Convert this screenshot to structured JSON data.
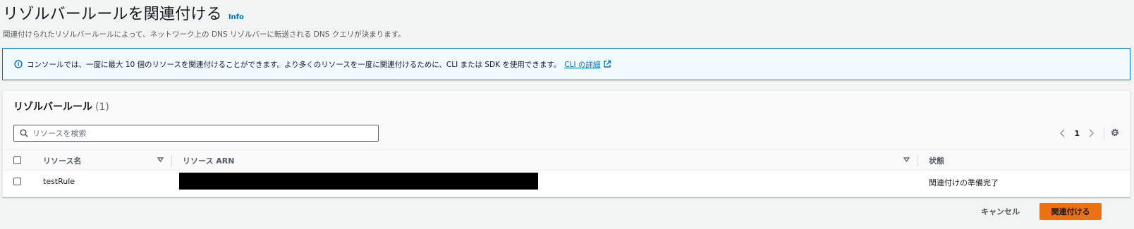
{
  "header": {
    "title": "リゾルバールールを関連付ける",
    "info_label": "Info",
    "description": "関連付けられたリゾルバールールによって、ネットワーク上の DNS リゾルバーに転送される DNS クエリが決まります。"
  },
  "alert": {
    "icon": "info-icon",
    "text": "コンソールでは、一度に最大 10 個のリソースを関連付けることができます。より多くのリソースを一度に関連付けるために、CLI または SDK を使用できます。",
    "link_label": "CLI の詳細",
    "link_icon": "external-link-icon"
  },
  "table": {
    "title": "リゾルバールール",
    "count": "(1)",
    "search": {
      "placeholder": "リソースを検索",
      "value": ""
    },
    "pagination": {
      "current_page": "1"
    },
    "columns": [
      "リソース名",
      "リソース ARN",
      "状態"
    ],
    "rows": [
      {
        "name": "testRule",
        "arn": "",
        "status": "関連付けの準備完了"
      }
    ]
  },
  "footer": {
    "cancel_label": "キャンセル",
    "submit_label": "関連付ける"
  },
  "colors": {
    "link": "#0073bb",
    "primary_button": "#ec7211",
    "alert_background": "#f1faff",
    "page_background": "#f2f3f3"
  }
}
